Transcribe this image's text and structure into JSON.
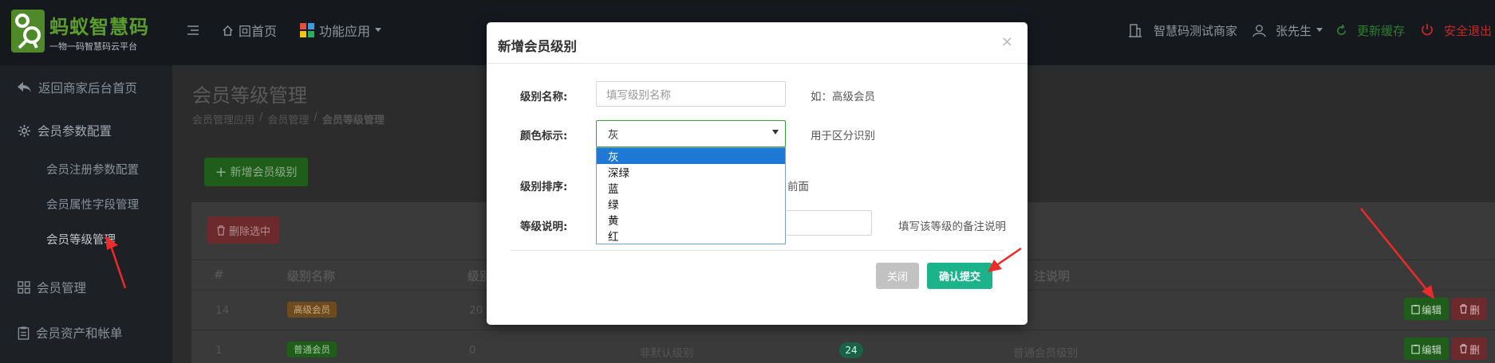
{
  "brand": {
    "name": "蚂蚁智慧码",
    "tagline": "一物一码智慧码云平台"
  },
  "topnav": {
    "home": "回首页",
    "apps": "功能应用"
  },
  "topright": {
    "merchant": "智慧码测试商家",
    "user": "张先生",
    "refresh": "更新缓存",
    "logout": "安全退出"
  },
  "sidebar": {
    "back": "返回商家后台首页",
    "section": "会员参数配置",
    "subitems": [
      "会员注册参数配置",
      "会员属性字段管理",
      "会员等级管理"
    ],
    "items": [
      "会员管理",
      "会员资产和帐单"
    ]
  },
  "page": {
    "title": "会员等级管理",
    "breadcrumb": [
      "会员管理应用",
      "会员管理",
      "会员等级管理"
    ],
    "add_button": "新增会员级别",
    "delete_button": "删除选中"
  },
  "table": {
    "headers": [
      "#",
      "级别名称",
      "级别",
      "注说明"
    ],
    "rows": [
      {
        "id": "14",
        "name": "高级会员",
        "level": "20",
        "default": "",
        "count": "",
        "note": ""
      },
      {
        "id": "1",
        "name": "普通会员",
        "level": "0",
        "default": "非默认级别",
        "count": "24",
        "note": "普通会员级别"
      }
    ],
    "edit_label": "编辑",
    "del_label": "删"
  },
  "modal": {
    "title": "新增会员级别",
    "close_symbol": "×",
    "fields": {
      "name_label": "级别名称:",
      "name_placeholder": "填写级别名称",
      "name_hint": "如：高级会员",
      "color_label": "颜色标示:",
      "color_value": "灰",
      "color_hint": "用于区分识别",
      "sort_label": "级别排序:",
      "sort_hint": "前面",
      "desc_label": "等级说明:",
      "desc_hint": "填写该等级的备注说明"
    },
    "color_options": [
      "灰",
      "深绿",
      "蓝",
      "绿",
      "黄",
      "红"
    ],
    "close_button": "关闭",
    "submit_button": "确认提交"
  },
  "colors": {
    "brand_green": "#5b9d2e",
    "accent_teal": "#1cb38b",
    "topbar": "#15191e",
    "sidebar": "#1d2126",
    "refresh_green": "#2e7d32",
    "logout_red": "#c62828",
    "annotation_red": "#ee2a2a"
  }
}
